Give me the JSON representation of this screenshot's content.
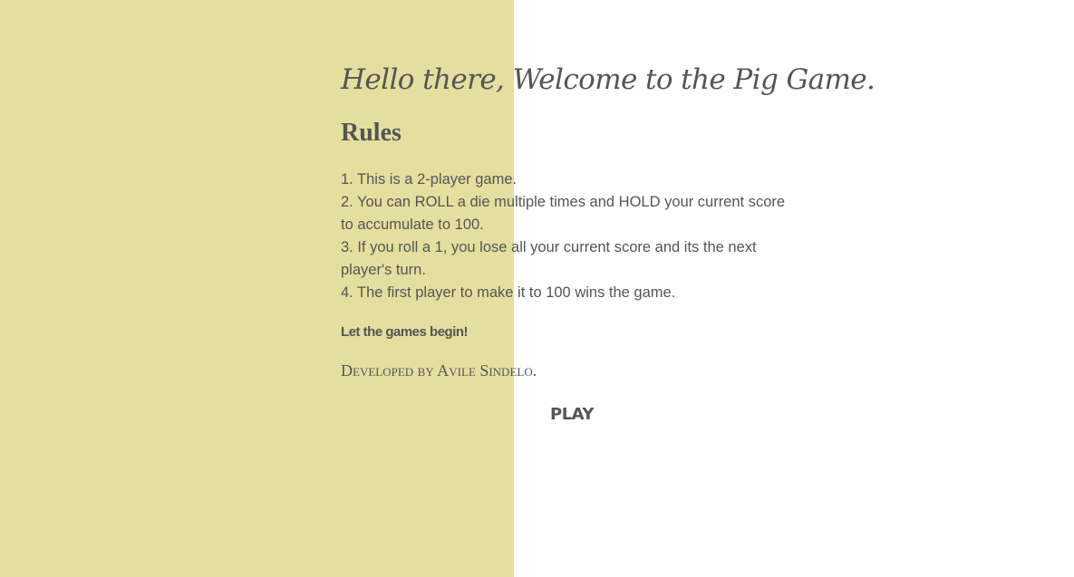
{
  "welcome_title": "Hello there, Welcome to the Pig Game.",
  "rules": {
    "heading": "Rules",
    "items": [
      "1. This is a 2-player game.",
      "2. You can ROLL a die multiple times and HOLD your current score to accumulate to 100.",
      "3. If you roll a 1, you lose all your current score and its the next player's turn.",
      "4. The first player to make it to 100 wins the game."
    ]
  },
  "tagline": "Let the games begin!",
  "credit": "Developed by Avile Sindelo.",
  "play_label": "PLAY",
  "colors": {
    "left_panel": "#e4df9f",
    "background": "#ffffff",
    "text": "#555555"
  }
}
